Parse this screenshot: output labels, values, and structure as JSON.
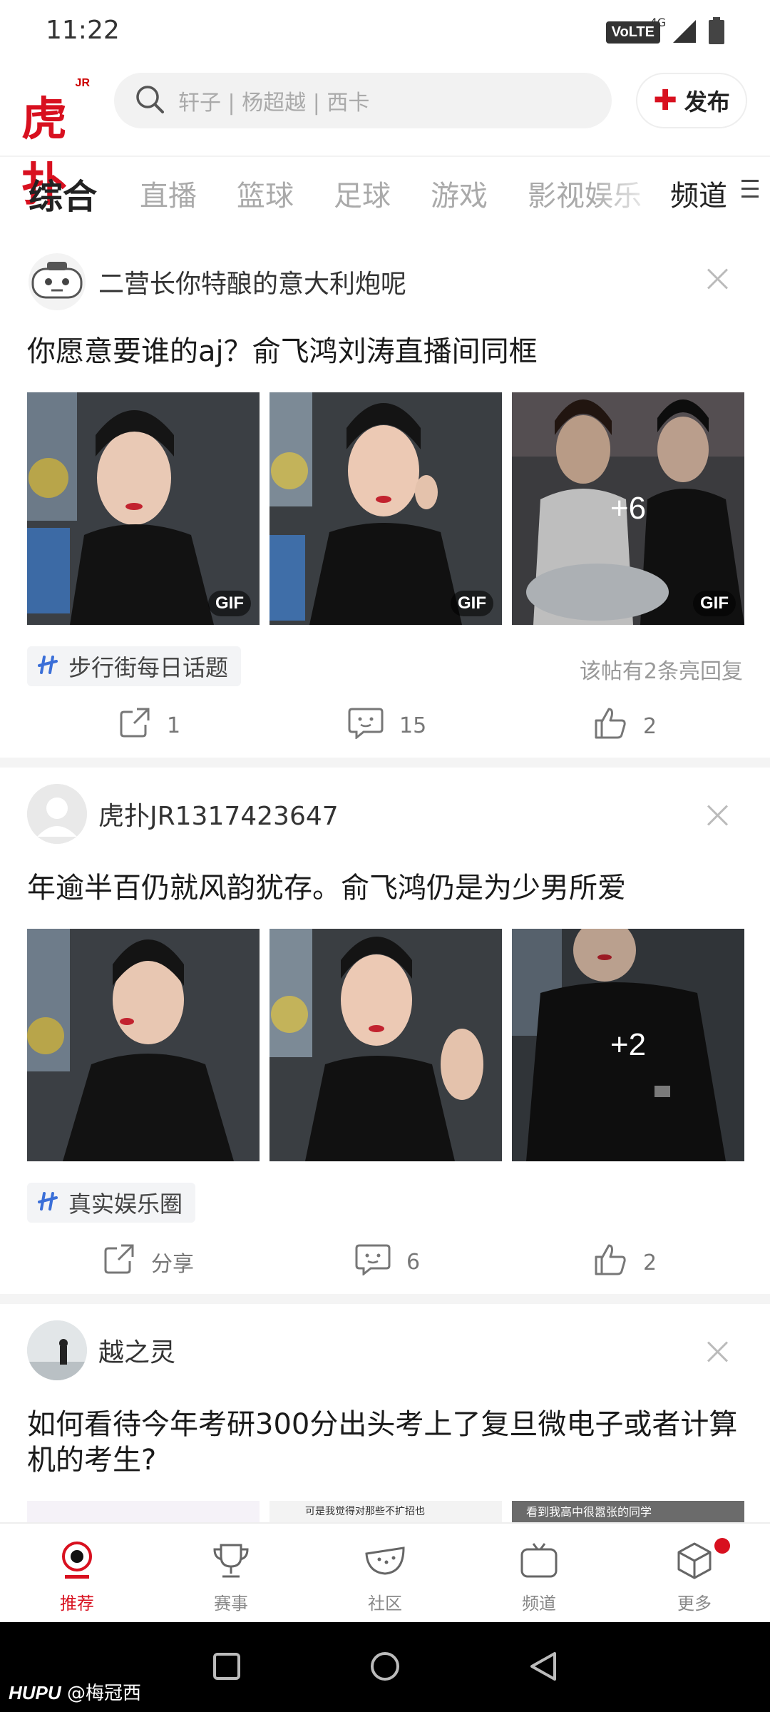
{
  "status_bar": {
    "time": "11:22",
    "volte": "VoLTE",
    "network": "4G"
  },
  "header": {
    "logo_text": "虎扑",
    "logo_sup": "JR",
    "search_placeholder": "轩子 | 杨超越 | 西卡",
    "publish_label": "发布"
  },
  "tabs": {
    "items": [
      "综合",
      "直播",
      "篮球",
      "足球",
      "游戏",
      "影视娱乐"
    ],
    "active": "综合",
    "channel_label": "频道"
  },
  "posts": [
    {
      "author": "二营长你特酿的意大利炮呢",
      "title": "你愿意要谁的aj？俞飞鸿刘涛直播间同框",
      "images": [
        {
          "badge": "GIF"
        },
        {
          "badge": "GIF"
        },
        {
          "badge": "GIF",
          "more": "+6"
        }
      ],
      "topic": "步行街每日话题",
      "replies_note": "该帖有2条亮回复",
      "share": "1",
      "comments": "15",
      "likes": "2"
    },
    {
      "author": "虎扑JR1317423647",
      "title": "年逾半百仍就风韵犹存。俞飞鸿仍是为少男所爱",
      "images": [
        {},
        {},
        {
          "more": "+2"
        }
      ],
      "topic": "真实娱乐圈",
      "share": "分享",
      "comments": "6",
      "likes": "2"
    },
    {
      "author": "越之灵",
      "title": "如何看待今年考研300分出头考上了复旦微电子或者计算机的考生?",
      "image_captions": [
        "可是我觉得对那些不扩招也",
        "看到我高中很嚣张的同学"
      ]
    }
  ],
  "bottom_nav": [
    {
      "label": "推荐",
      "icon": "recommend-icon",
      "active": true
    },
    {
      "label": "赛事",
      "icon": "trophy-icon"
    },
    {
      "label": "社区",
      "icon": "watermelon-icon"
    },
    {
      "label": "频道",
      "icon": "tv-icon"
    },
    {
      "label": "更多",
      "icon": "cube-icon",
      "badge": true
    }
  ],
  "watermark": {
    "brand": "HUPU",
    "user": "@梅冠西"
  },
  "colors": {
    "brand_red": "#d8101f",
    "topic_blue": "#3b6fd8"
  }
}
